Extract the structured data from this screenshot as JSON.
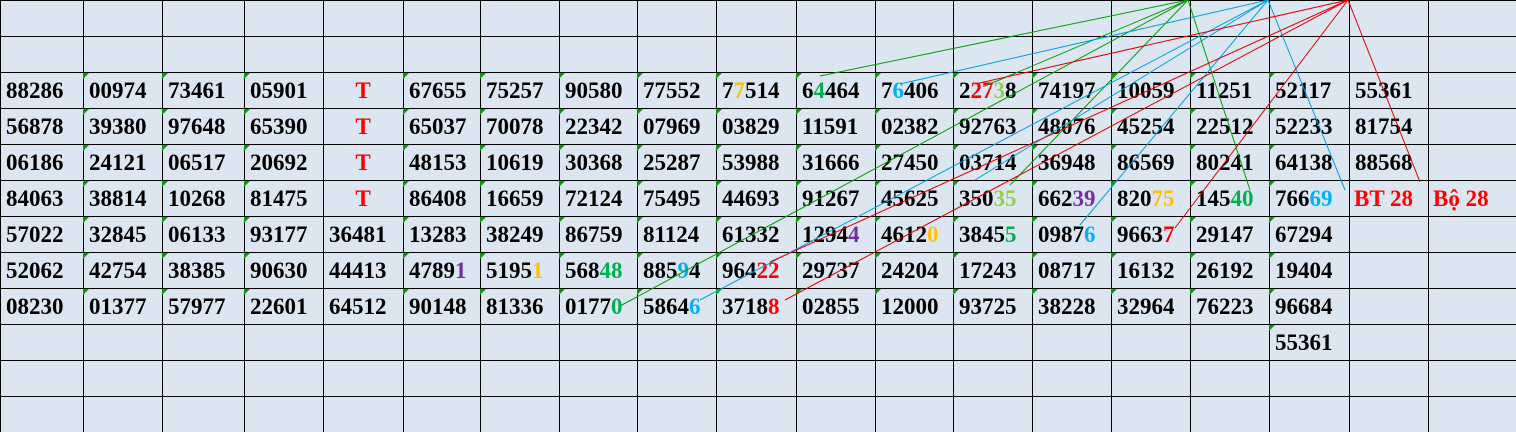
{
  "colors": {
    "background": "#dce6f1",
    "grid": "#000000",
    "red": "#ff0000",
    "green": "#00b050",
    "blue": "#00b0f0",
    "purple": "#7030a0",
    "orange": "#ffc000",
    "light_green": "#92d050",
    "line_green": "#00a000",
    "line_blue": "#00a0e0",
    "line_red": "#e00000"
  },
  "rows": [
    [],
    [],
    [
      "88286",
      "00974",
      "73461",
      "05901",
      "T",
      "67655",
      "75257",
      "90580",
      "77552",
      "77514",
      "64464",
      "76406",
      "22738",
      "74197",
      "10059",
      "11251",
      "52117",
      "55361"
    ],
    [
      "56878",
      "39380",
      "97648",
      "65390",
      "T",
      "65037",
      "70078",
      "22342",
      "07969",
      "03829",
      "11591",
      "02382",
      "92763",
      "48076",
      "45254",
      "22512",
      "52233",
      "81754"
    ],
    [
      "06186",
      "24121",
      "06517",
      "20692",
      "T",
      "48153",
      "10619",
      "30368",
      "25287",
      "53988",
      "31666",
      "27450",
      "03714",
      "36948",
      "86569",
      "80241",
      "64138",
      "88568"
    ],
    [
      "84063",
      "38814",
      "10268",
      "81475",
      "T",
      "86408",
      "16659",
      "72124",
      "75495",
      "44693",
      "91267",
      "45625",
      "35035",
      "66239",
      "82075",
      "14540",
      "76669",
      "BT 28",
      "Bộ 28"
    ],
    [
      "57022",
      "32845",
      "06133",
      "93177",
      "36481",
      "13283",
      "38249",
      "86759",
      "81124",
      "61332",
      "12944",
      "46120",
      "38455",
      "09876",
      "96637",
      "29147",
      "67294"
    ],
    [
      "52062",
      "42754",
      "38385",
      "90630",
      "44413",
      "47891",
      "51951",
      "56848",
      "88594",
      "96422",
      "29737",
      "24204",
      "17243",
      "08717",
      "16132",
      "26192",
      "19404"
    ],
    [
      "08230",
      "01377",
      "57977",
      "22601",
      "64512",
      "90148",
      "81336",
      "01770",
      "58646",
      "37188",
      "02855",
      "12000",
      "93725",
      "38228",
      "32964",
      "76223",
      "96684"
    ],
    [
      "",
      "",
      "",
      "",
      "",
      "",
      "",
      "",
      "",
      "",
      "",
      "",
      "",
      "",
      "",
      "",
      "55361"
    ],
    [],
    []
  ]
}
